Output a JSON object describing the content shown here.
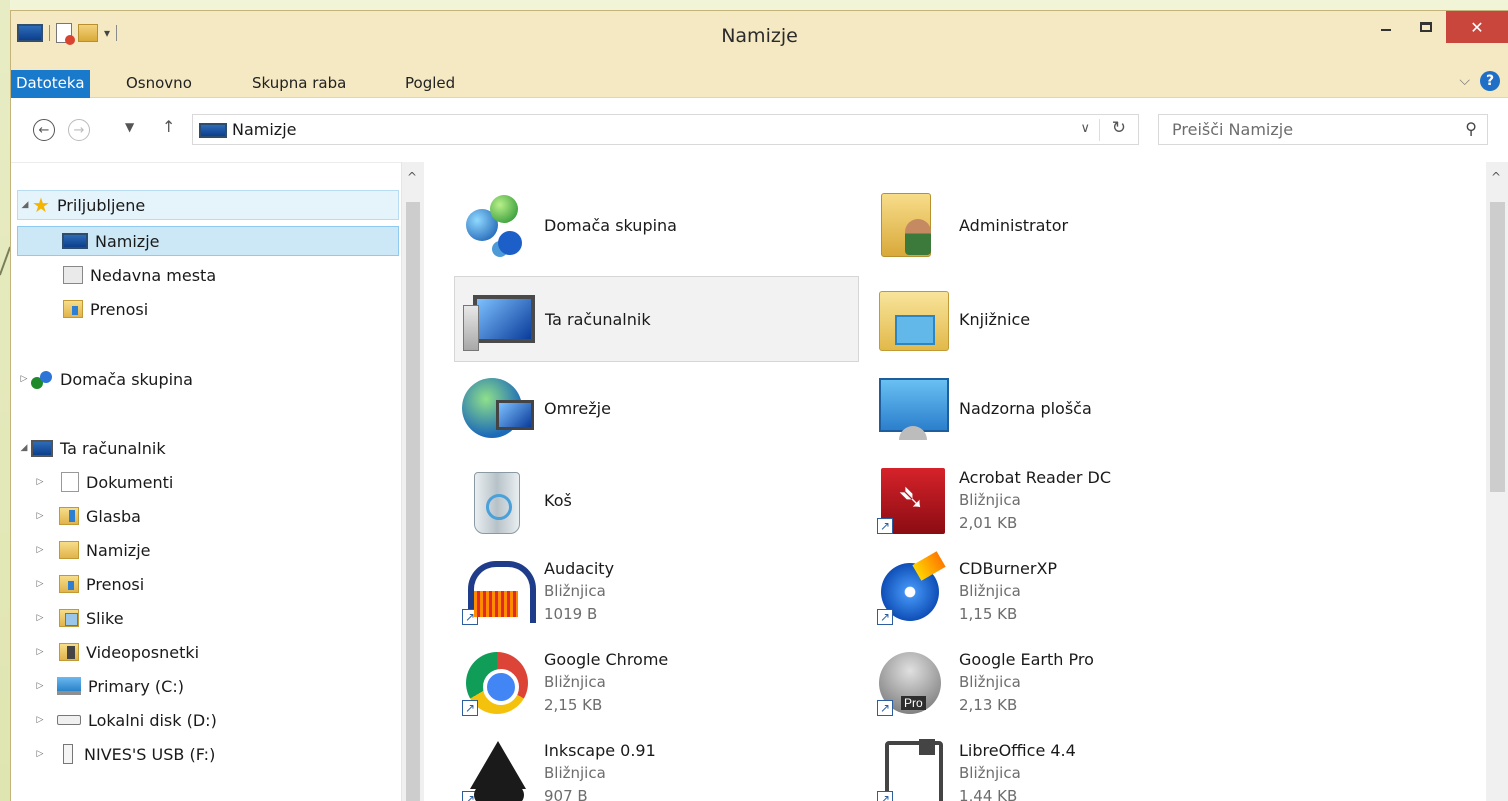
{
  "window": {
    "title": "Namizje",
    "controls": {
      "minimize": "minimize",
      "maximize": "maximize",
      "close": "✕"
    }
  },
  "ribbon": {
    "tabs": [
      "Datoteka",
      "Osnovno",
      "Skupna raba",
      "Pogled"
    ],
    "help": "?"
  },
  "address": {
    "path": "Namizje",
    "search_placeholder": "Preišči Namizje"
  },
  "nav": {
    "favorites": {
      "label": "Priljubljene",
      "items": [
        "Namizje",
        "Nedavna mesta",
        "Prenosi"
      ]
    },
    "homegroup": "Domača skupina",
    "this_pc": {
      "label": "Ta računalnik",
      "items": [
        "Dokumenti",
        "Glasba",
        "Namizje",
        "Prenosi",
        "Slike",
        "Videoposnetki",
        "Primary (C:)",
        "Lokalni disk (D:)",
        "NIVES'S USB (F:)"
      ]
    }
  },
  "items": [
    {
      "name": "Domača skupina"
    },
    {
      "name": "Administrator"
    },
    {
      "name": "Ta računalnik"
    },
    {
      "name": "Knjižnice"
    },
    {
      "name": "Omrežje"
    },
    {
      "name": "Nadzorna plošča"
    },
    {
      "name": "Koš"
    },
    {
      "name": "Acrobat Reader DC",
      "type": "Bližnjica",
      "size": "2,01 KB"
    },
    {
      "name": "Audacity",
      "type": "Bližnjica",
      "size": "1019 B"
    },
    {
      "name": "CDBurnerXP",
      "type": "Bližnjica",
      "size": "1,15 KB"
    },
    {
      "name": "Google Chrome",
      "type": "Bližnjica",
      "size": "2,15 KB"
    },
    {
      "name": "Google Earth Pro",
      "type": "Bližnjica",
      "size": "2,13 KB"
    },
    {
      "name": "Inkscape 0.91",
      "type": "Bližnjica",
      "size": "907 B"
    },
    {
      "name": "LibreOffice 4.4",
      "type": "Bližnjica",
      "size": "1,44 KB"
    }
  ]
}
